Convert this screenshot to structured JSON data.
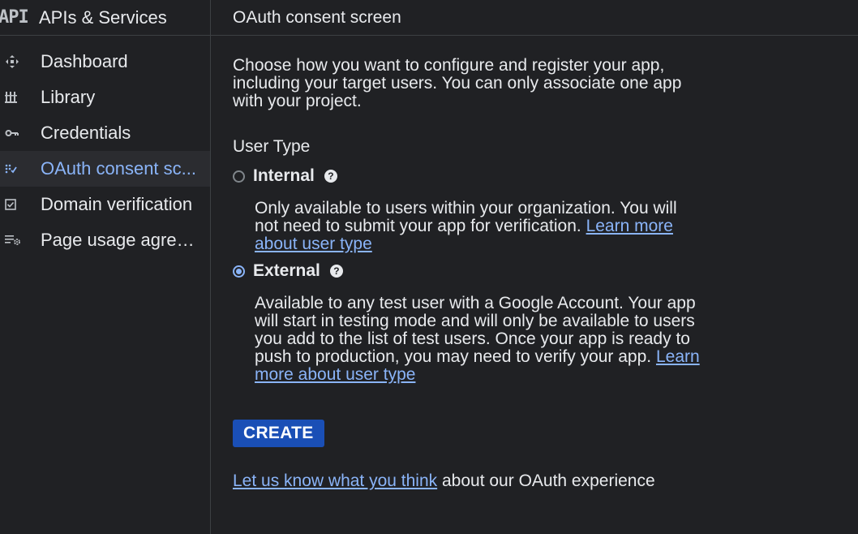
{
  "sidebar": {
    "logo": "API",
    "title": "APIs & Services",
    "items": [
      {
        "label": "Dashboard",
        "icon": "dashboard-icon",
        "active": false
      },
      {
        "label": "Library",
        "icon": "library-icon",
        "active": false
      },
      {
        "label": "Credentials",
        "icon": "key-icon",
        "active": false
      },
      {
        "label": "OAuth consent sc...",
        "icon": "consent-icon",
        "active": true
      },
      {
        "label": "Domain verification",
        "icon": "checkbox-icon",
        "active": false
      },
      {
        "label": "Page usage agree...",
        "icon": "settings-list-icon",
        "active": false
      }
    ]
  },
  "header": {
    "title": "OAuth consent screen"
  },
  "main": {
    "intro": "Choose how you want to configure and register your app, including your target users. You can only associate one app with your project.",
    "user_type_label": "User Type",
    "options": {
      "internal": {
        "label": "Internal",
        "selected": false,
        "description": "Only available to users within your organization. You will not need to submit your app for verification.",
        "link": "Learn more about user type"
      },
      "external": {
        "label": "External",
        "selected": true,
        "description": "Available to any test user with a Google Account. Your app will start in testing mode and will only be available to users you add to the list of test users. Once your app is ready to push to production, you may need to verify your app.",
        "link": "Learn more about user type"
      }
    },
    "help_glyph": "?",
    "create_label": "CREATE",
    "feedback_link": "Let us know what you think",
    "feedback_text": " about our OAuth experience"
  },
  "colors": {
    "background": "#202124",
    "accent": "#8ab4f8",
    "button": "#1a4fb6",
    "text": "#e8eaed"
  }
}
